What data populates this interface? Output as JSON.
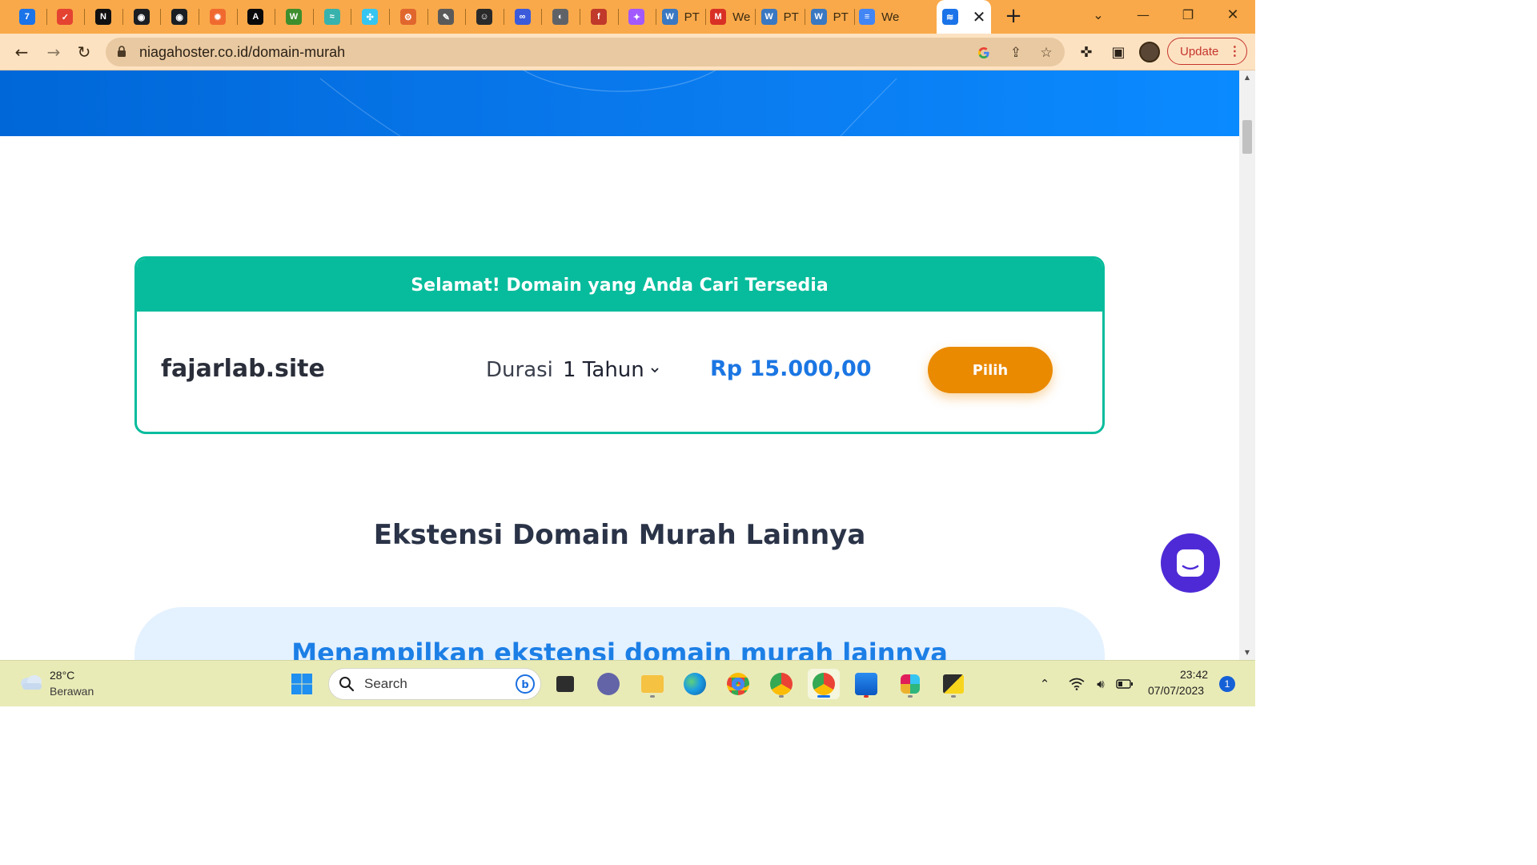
{
  "browser": {
    "tabs": [
      {
        "icon": "google-calendar-icon",
        "label": "",
        "color": "#1a73e8",
        "glyph": "7"
      },
      {
        "icon": "todoist-icon",
        "label": "",
        "color": "#e44332",
        "glyph": "✓"
      },
      {
        "icon": "notion-icon",
        "label": "",
        "color": "#111111",
        "glyph": "N"
      },
      {
        "icon": "github-icon",
        "label": "",
        "color": "#1b1f23",
        "glyph": "◉"
      },
      {
        "icon": "github-icon",
        "label": "",
        "color": "#1b1f23",
        "glyph": "◉"
      },
      {
        "icon": "asterisk-icon",
        "label": "",
        "color": "#f06a30",
        "glyph": "✹"
      },
      {
        "icon": "devto-icon",
        "label": "",
        "color": "#0a0a0a",
        "glyph": "A"
      },
      {
        "icon": "webflow-w-icon",
        "label": "",
        "color": "#3e8e2e",
        "glyph": "W"
      },
      {
        "icon": "tailwind-icon",
        "label": "",
        "color": "#38b2ac",
        "glyph": "≈"
      },
      {
        "icon": "slack-cross-icon",
        "label": "",
        "color": "#36c5f0",
        "glyph": "✣"
      },
      {
        "icon": "openai-icon",
        "label": "",
        "color": "#e0662e",
        "glyph": "⚙"
      },
      {
        "icon": "feather-icon",
        "label": "",
        "color": "#5a5a5a",
        "glyph": "✎"
      },
      {
        "icon": "trello-mask-icon",
        "label": "",
        "color": "#2a2a2a",
        "glyph": "☺"
      },
      {
        "icon": "infinity-icon",
        "label": "",
        "color": "#3b5bdb",
        "glyph": "∞"
      },
      {
        "icon": "globe-icon",
        "label": "",
        "color": "#5f6368",
        "glyph": "◐"
      },
      {
        "icon": "freecodecamp-icon",
        "label": "",
        "color": "#c0392b",
        "glyph": "f"
      },
      {
        "icon": "figma-icon",
        "label": "",
        "color": "#a259ff",
        "glyph": "✦"
      },
      {
        "icon": "wordpress-pt-icon",
        "label": "PT",
        "color": "#3a78c2",
        "glyph": "W"
      },
      {
        "icon": "gmail-icon",
        "label": "We",
        "color": "#d93025",
        "glyph": "M"
      },
      {
        "icon": "wordpress-pt-icon",
        "label": "PT",
        "color": "#3a78c2",
        "glyph": "W"
      },
      {
        "icon": "wordpress-pt-icon",
        "label": "PT",
        "color": "#3a78c2",
        "glyph": "W"
      },
      {
        "icon": "google-docs-icon",
        "label": "We",
        "color": "#4285f4",
        "glyph": "≡"
      },
      {
        "icon": "niagahoster-icon",
        "label": "",
        "color": "#1a73e8",
        "glyph": "≋",
        "active": true
      }
    ],
    "url": "niagahoster.co.id/domain-murah",
    "update_label": "Update"
  },
  "page": {
    "result_header": "Selamat! Domain yang Anda Cari Tersedia",
    "domain_name": "fajarlab.site",
    "duration_label": "Durasi",
    "duration_value": "1 Tahun",
    "price": "Rp 15.000,00",
    "select_button": "Pilih",
    "section_title": "Ekstensi Domain Murah Lainnya",
    "extension_text": "Menampilkan ekstensi domain murah lainnya"
  },
  "taskbar": {
    "weather_temp": "28°C",
    "weather_desc": "Berawan",
    "search_label": "Search",
    "time": "23:42",
    "date": "07/07/2023",
    "notification_count": "1"
  },
  "colors": {
    "tab_strip": "#f9a94a",
    "toolbar": "#fde2c2",
    "hero_blue": "#0a7cf0",
    "success_green": "#07bc9c",
    "price_blue": "#1b76e3",
    "cta_orange": "#ea8a00",
    "chat_purple": "#4e2ad6",
    "taskbar": "#e9ebb7"
  }
}
